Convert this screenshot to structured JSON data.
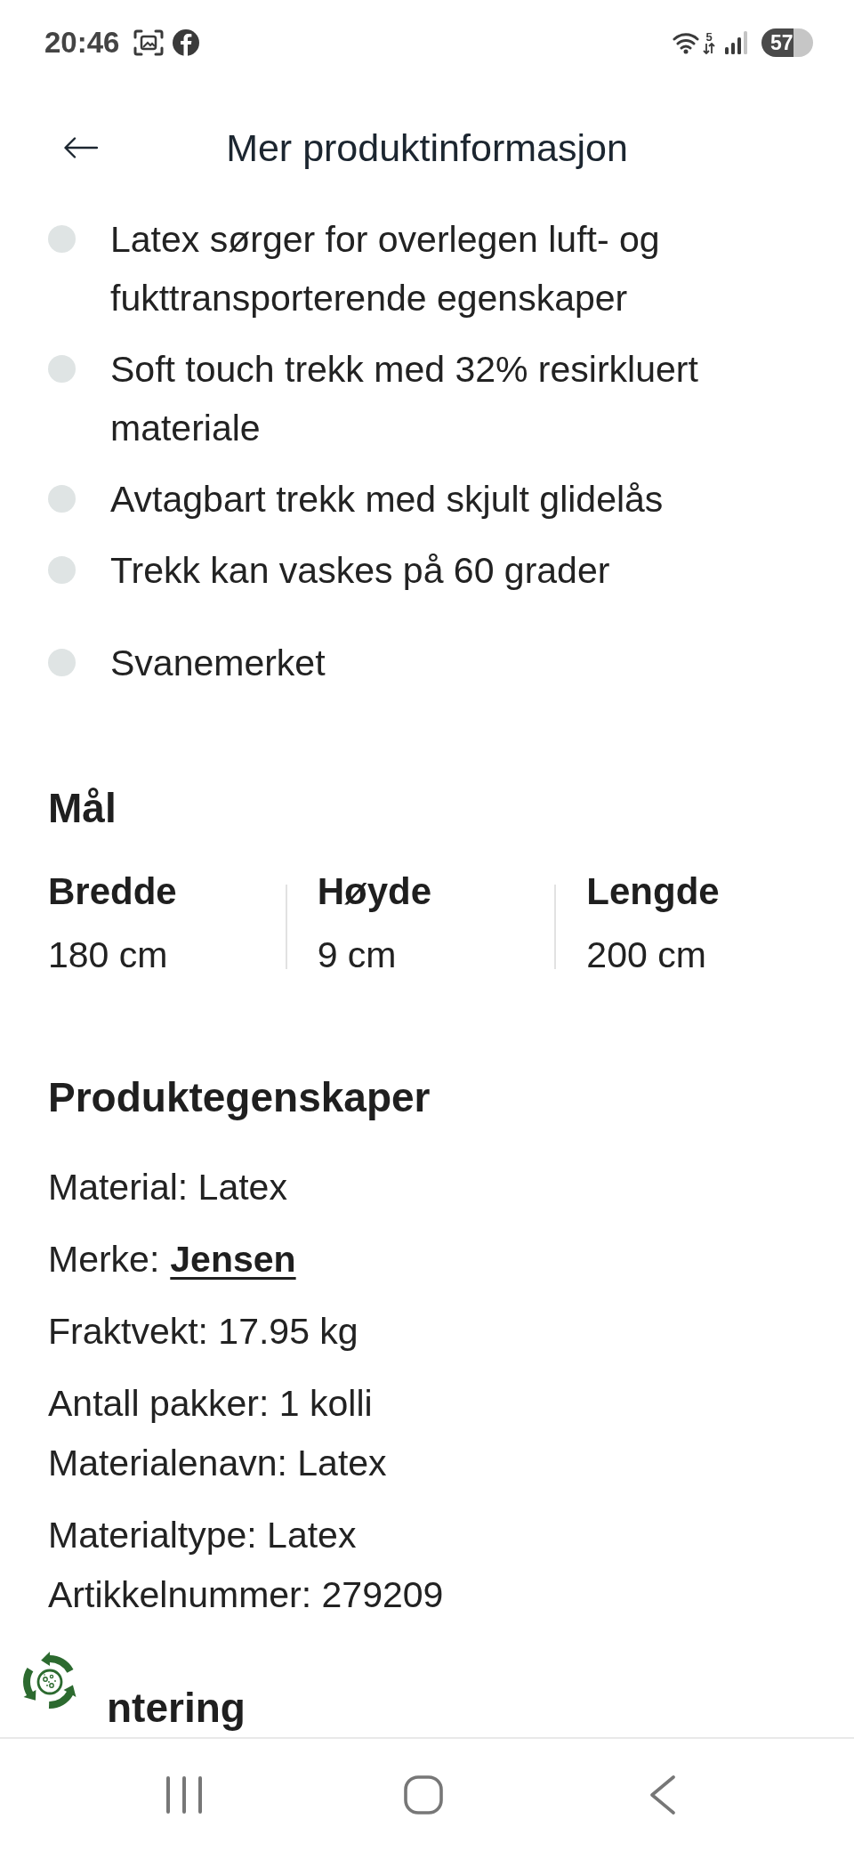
{
  "status_bar": {
    "time": "20:46",
    "network": "5",
    "battery": "57"
  },
  "header": {
    "title": "Mer produktinformasjon"
  },
  "features": [
    "Latex sørger for overlegen luft- og fukttransporterende egenskaper",
    "Soft touch trekk med 32% resirkluert materiale",
    "Avtagbart trekk med skjult glidelås",
    "Trekk kan vaskes på 60 grader",
    "Svanemerket"
  ],
  "dimensions": {
    "title": "Mål",
    "items": [
      {
        "label": "Bredde",
        "value": "180 cm"
      },
      {
        "label": "Høyde",
        "value": "9 cm"
      },
      {
        "label": "Lengde",
        "value": "200 cm"
      }
    ]
  },
  "properties": {
    "title": "Produktegenskaper",
    "paragraphs": [
      {
        "lines": [
          {
            "kind": "text",
            "text": "Material: Latex"
          }
        ]
      },
      {
        "lines": [
          {
            "kind": "link",
            "label": "Merke:",
            "link": "Jensen"
          }
        ]
      },
      {
        "lines": [
          {
            "kind": "text",
            "text": "Fraktvekt: 17.95 kg"
          }
        ]
      },
      {
        "lines": [
          {
            "kind": "text",
            "text": "Antall pakker: 1 kolli"
          },
          {
            "kind": "text",
            "text": "Materialenavn: Latex"
          }
        ]
      },
      {
        "lines": [
          {
            "kind": "text",
            "text": "Materialtype: Latex"
          },
          {
            "kind": "text",
            "text": "Artikkelnummer: 279209"
          }
        ]
      }
    ]
  },
  "next_section": {
    "title": "ntering"
  }
}
